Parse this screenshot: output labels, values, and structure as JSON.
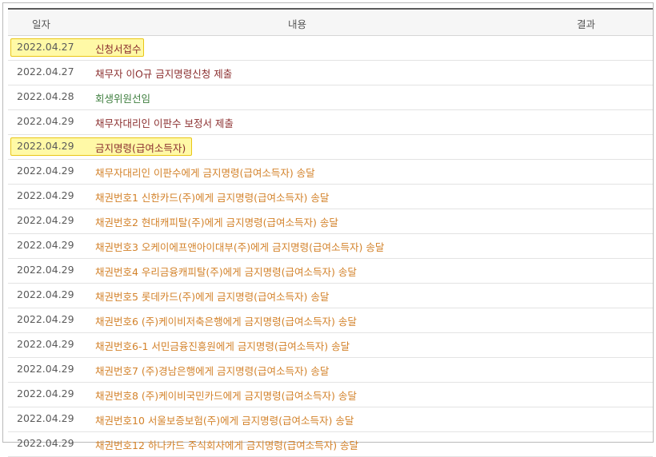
{
  "header": {
    "date": "일자",
    "content": "내용",
    "result": "결과"
  },
  "colors": {
    "maroon": "#8b2f2f",
    "green": "#3f7f3f",
    "orange": "#d3822a",
    "highlight": "#fdf59a"
  },
  "rows": [
    {
      "date": "2022.04.27",
      "content": "신청서접수",
      "tone": "maroon",
      "highlighted": true
    },
    {
      "date": "2022.04.27",
      "content": "채무자 이O규 금지명령신청 제출",
      "tone": "maroon",
      "highlighted": false
    },
    {
      "date": "2022.04.28",
      "content": "회생위원선임",
      "tone": "green",
      "highlighted": false
    },
    {
      "date": "2022.04.29",
      "content": "채무자대리인 이판수 보정서 제출",
      "tone": "maroon",
      "highlighted": false
    },
    {
      "date": "2022.04.29",
      "content": "금지명령(급여소득자)",
      "tone": "maroon",
      "highlighted": true
    },
    {
      "date": "2022.04.29",
      "content": "채무자대리인 이판수에게 금지명령(급여소득자) 송달",
      "tone": "orange",
      "highlighted": false
    },
    {
      "date": "2022.04.29",
      "content": "채권번호1 신한카드(주)에게 금지명령(급여소득자) 송달",
      "tone": "orange",
      "highlighted": false
    },
    {
      "date": "2022.04.29",
      "content": "채권번호2 현대캐피탈(주)에게 금지명령(급여소득자) 송달",
      "tone": "orange",
      "highlighted": false
    },
    {
      "date": "2022.04.29",
      "content": "채권번호3 오케이에프앤아이대부(주)에게 금지명령(급여소득자) 송달",
      "tone": "orange",
      "highlighted": false
    },
    {
      "date": "2022.04.29",
      "content": "채권번호4 우리금융캐피탈(주)에게 금지명령(급여소득자) 송달",
      "tone": "orange",
      "highlighted": false
    },
    {
      "date": "2022.04.29",
      "content": "채권번호5 롯데카드(주)에게 금지명령(급여소득자) 송달",
      "tone": "orange",
      "highlighted": false
    },
    {
      "date": "2022.04.29",
      "content": "채권번호6 (주)케이비저축은행에게 금지명령(급여소득자) 송달",
      "tone": "orange",
      "highlighted": false
    },
    {
      "date": "2022.04.29",
      "content": "채권번호6-1 서민금융진흥원에게 금지명령(급여소득자) 송달",
      "tone": "orange",
      "highlighted": false
    },
    {
      "date": "2022.04.29",
      "content": "채권번호7 (주)경남은행에게 금지명령(급여소득자) 송달",
      "tone": "orange",
      "highlighted": false
    },
    {
      "date": "2022.04.29",
      "content": "채권번호8 (주)케이비국민카드에게 금지명령(급여소득자) 송달",
      "tone": "orange",
      "highlighted": false
    },
    {
      "date": "2022.04.29",
      "content": "채권번호10 서울보증보험(주)에게 금지명령(급여소득자) 송달",
      "tone": "orange",
      "highlighted": false
    },
    {
      "date": "2022.04.29",
      "content": "채권번호12 하나카드 주식회사에게 금지명령(급여소득자) 송달",
      "tone": "orange",
      "highlighted": false
    }
  ]
}
